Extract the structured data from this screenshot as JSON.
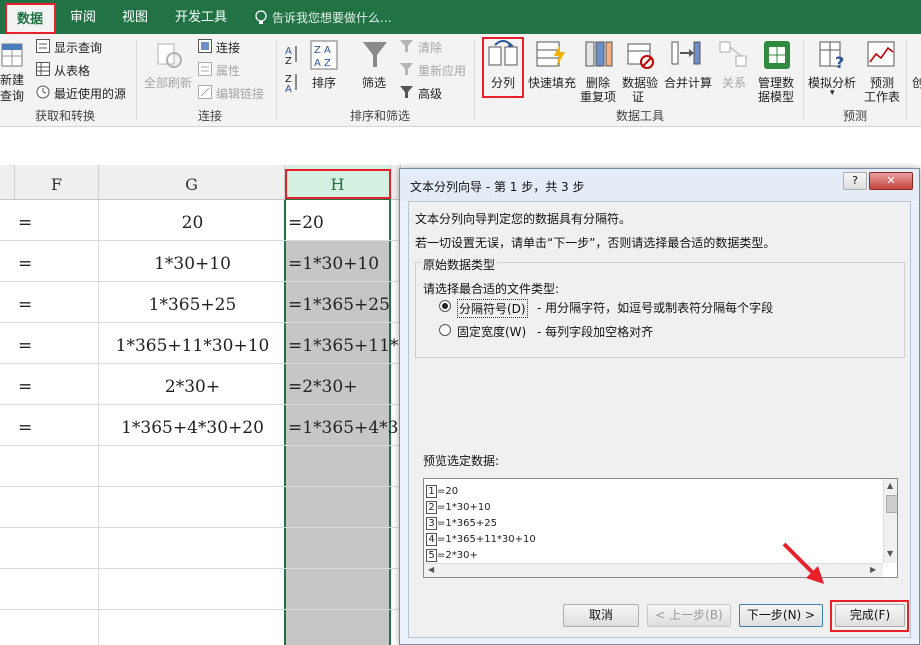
{
  "tabs": [
    {
      "label": "数据",
      "active": true
    },
    {
      "label": "审阅"
    },
    {
      "label": "视图"
    },
    {
      "label": "开发工具"
    }
  ],
  "tell_me": "告诉我您想要做什么...",
  "ribbon": {
    "get_transform": {
      "new_query_1": "新建",
      "new_query_2": "查询",
      "show_queries": "显示查询",
      "from_table": "从表格",
      "recent_sources": "最近使用的源",
      "label": "获取和转换"
    },
    "connections": {
      "refresh_all": "全部刷新",
      "connections": "连接",
      "properties": "属性",
      "edit_links": "编辑链接",
      "label": "连接"
    },
    "sort_filter": {
      "sort": "排序",
      "filter": "筛选",
      "clear": "清除",
      "reapply": "重新应用",
      "advanced": "高级",
      "label": "排序和筛选"
    },
    "data_tools": {
      "text_to_columns": "分列",
      "flash_fill": "快速填充",
      "remove_dup_1": "删除",
      "remove_dup_2": "重复项",
      "validation_1": "数据验",
      "validation_2": "证",
      "consolidate": "合并计算",
      "relationships": "关系",
      "manage_model_1": "管理数",
      "manage_model_2": "据模型",
      "label": "数据工具"
    },
    "forecast": {
      "what_if": "模拟分析",
      "forecast_1": "预测",
      "forecast_2": "工作表",
      "label": "预测"
    },
    "outline_partial": "创"
  },
  "grid": {
    "columns": [
      "F",
      "G",
      "H"
    ],
    "rows": [
      {
        "f": "=",
        "g": "20",
        "h": "=20"
      },
      {
        "f": "=",
        "g": "1*30+10",
        "h": "=1*30+10"
      },
      {
        "f": "=",
        "g": "1*365+25",
        "h": "=1*365+25"
      },
      {
        "f": "=",
        "g": "1*365+11*30+10",
        "h": "=1*365+11*"
      },
      {
        "f": "=",
        "g": "2*30+",
        "h": "=2*30+"
      },
      {
        "f": "=",
        "g": "1*365+4*30+20",
        "h": "=1*365+4*3"
      }
    ]
  },
  "dialog": {
    "title": "文本分列向导 - 第 1 步，共 3 步",
    "help": "?",
    "close": "✕",
    "intro": "文本分列向导判定您的数据具有分隔符。",
    "instruction": "若一切设置无误，请单击“下一步”，否则请选择最合适的数据类型。",
    "group_title": "原始数据类型",
    "file_type_prompt": "请选择最合适的文件类型:",
    "options": [
      {
        "label": "分隔符号(D)",
        "desc": "- 用分隔字符，如逗号或制表符分隔每个字段",
        "selected": true
      },
      {
        "label": "固定宽度(W)",
        "desc": "- 每列字段加空格对齐",
        "selected": false
      }
    ],
    "preview_label": "预览选定数据:",
    "preview_rows": [
      {
        "n": "1",
        "text": "=20"
      },
      {
        "n": "2",
        "text": "=1*30+10"
      },
      {
        "n": "3",
        "text": "=1*365+25"
      },
      {
        "n": "4",
        "text": "=1*365+11*30+10"
      },
      {
        "n": "5",
        "text": "=2*30+"
      }
    ],
    "buttons": {
      "cancel": "取消",
      "back": "< 上一步(B)",
      "next": "下一步(N) >",
      "finish": "完成(F)"
    }
  },
  "colors": {
    "excel_green": "#217346",
    "highlight_red": "#e8202a",
    "selection_gray": "#c6c6c6"
  }
}
